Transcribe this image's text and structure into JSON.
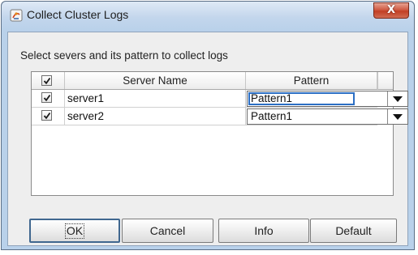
{
  "window": {
    "title": "Collect Cluster Logs",
    "close_label": "X"
  },
  "content": {
    "instruction": "Select severs and its pattern to collect logs"
  },
  "table": {
    "columns": {
      "select_all_checked": true,
      "server_name": "Server Name",
      "pattern": "Pattern"
    },
    "rows": [
      {
        "checked": true,
        "server": "server1",
        "pattern": "Pattern1"
      },
      {
        "checked": true,
        "server": "server2",
        "pattern": "Pattern1"
      }
    ]
  },
  "buttons": {
    "ok": "OK",
    "cancel": "Cancel",
    "info": "Info",
    "default": "Default"
  },
  "colors": {
    "frame": "#b9d1ea",
    "close_button": "#c23f24",
    "focus_border": "#2c6fc4"
  },
  "icons": [
    "app-icon",
    "close-icon",
    "checkbox-check-icon",
    "dropdown-arrow-icon"
  ]
}
